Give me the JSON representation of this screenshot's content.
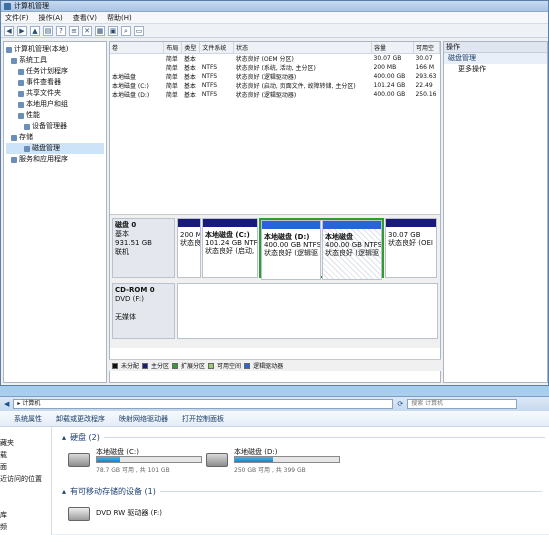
{
  "window": {
    "title": "计算机管理"
  },
  "menu": [
    "文件(F)",
    "操作(A)",
    "查看(V)",
    "帮助(H)"
  ],
  "tree": [
    {
      "label": "计算机管理(本地)",
      "level": 0
    },
    {
      "label": "系统工具",
      "level": 1
    },
    {
      "label": "任务计划程序",
      "level": 2
    },
    {
      "label": "事件查看器",
      "level": 2
    },
    {
      "label": "共享文件夹",
      "level": 2
    },
    {
      "label": "本地用户和组",
      "level": 2
    },
    {
      "label": "性能",
      "level": 2
    },
    {
      "label": "设备管理器",
      "level": 2
    },
    {
      "label": "存储",
      "level": 1
    },
    {
      "label": "磁盘管理",
      "level": 2
    },
    {
      "label": "服务和应用程序",
      "level": 1
    }
  ],
  "volumes": {
    "headers": [
      "卷",
      "布局",
      "类型",
      "文件系统",
      "状态",
      "容量",
      "可用空"
    ],
    "rows": [
      [
        "",
        "简单",
        "基本",
        "",
        "状态良好 (OEM 分区)",
        "30.07 GB",
        "30.07"
      ],
      [
        "",
        "简单",
        "基本",
        "NTFS",
        "状态良好 (系统, 活动, 主分区)",
        "200 MB",
        "166 M"
      ],
      [
        "本地磁盘",
        "简单",
        "基本",
        "NTFS",
        "状态良好 (逻辑驱动器)",
        "400.00 GB",
        "293.63"
      ],
      [
        "本地磁盘 (C:)",
        "简单",
        "基本",
        "NTFS",
        "状态良好 (启动, 页面文件, 故障转储, 主分区)",
        "101.24 GB",
        "22.49"
      ],
      [
        "本地磁盘 (D:)",
        "简单",
        "基本",
        "NTFS",
        "状态良好 (逻辑驱动器)",
        "400.00 GB",
        "250.16"
      ]
    ]
  },
  "disk0": {
    "name": "磁盘 0",
    "type": "基本",
    "size": "931.51 GB",
    "state": "联机",
    "p1": {
      "l1": "200 M",
      "l2": "状态良"
    },
    "pc": {
      "title": "本地磁盘 (C:)",
      "size": "101.24 GB NTF",
      "state": "状态良好 (启动,"
    },
    "pd": {
      "title": "本地磁盘 (D:)",
      "size": "400.00 GB NTFS",
      "state": "状态良好 (逻辑驱"
    },
    "pe": {
      "title": "本地磁盘",
      "size": "400.00 GB NTFS",
      "state": "状态良好 (逻辑驱"
    },
    "po": {
      "size": "30.07 GB",
      "state": "状态良好 (OEI"
    }
  },
  "cdrom": {
    "name": "CD-ROM 0",
    "type": "DVD (F:)",
    "state": "无媒体"
  },
  "legend": [
    "未分配",
    "主分区",
    "扩展分区",
    "可用空间",
    "逻辑驱动器"
  ],
  "legend_colors": [
    "#111111",
    "#1a1a7a",
    "#2f9c2f",
    "#9ccc6a",
    "#2a62d8"
  ],
  "actions": {
    "header": "操作",
    "section": "磁盘管理",
    "item": "更多操作"
  },
  "explorer": {
    "path": "计算机",
    "search": "搜索 计算机",
    "cmds": [
      "系统属性",
      "卸载或更改程序",
      "映射网络驱动器",
      "打开控制面板"
    ],
    "nav": [
      "藏夹",
      "载",
      "面",
      "近访问的位置",
      "",
      "",
      "库",
      "频"
    ],
    "hdd_group": "硬盘 (2)",
    "drives": [
      {
        "name": "本地磁盘 (C:)",
        "size": "78.7 GB 可用 , 共 101 GB",
        "used": 0.22
      },
      {
        "name": "本地磁盘 (D:)",
        "size": "250 GB 可用 , 共 399 GB",
        "used": 0.37
      }
    ],
    "removable_group": "有可移动存储的设备 (1)",
    "dvd": "DVD RW 驱动器 (F:)"
  }
}
